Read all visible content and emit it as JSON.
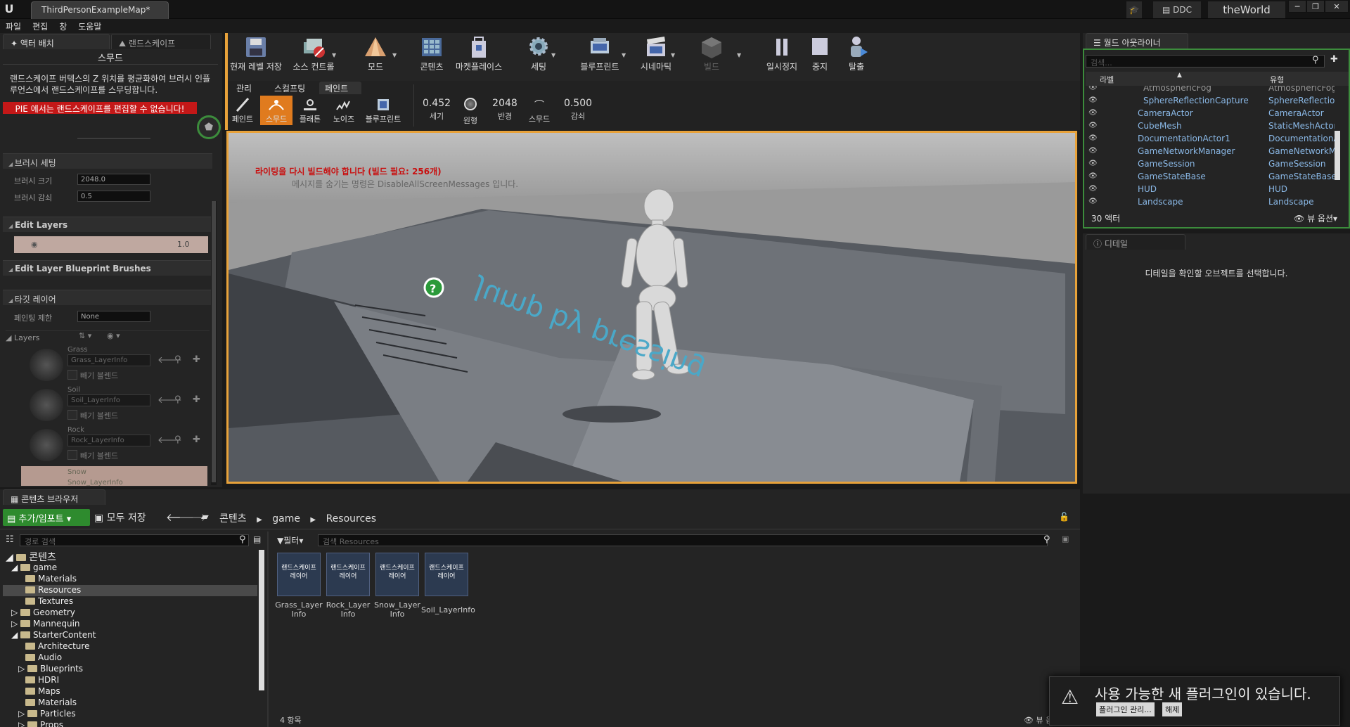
{
  "app": {
    "document_tab": "ThirdPersonExampleMap*",
    "ddc": "DDC",
    "world": "theWorld"
  },
  "menu": [
    "파일",
    "편집",
    "창",
    "도움말"
  ],
  "left_panel": {
    "tabs": [
      "액터 배치",
      "랜드스케이프"
    ],
    "tool_title": "스무드",
    "description": "랜드스케이프 버텍스의 Z 위치를 평균화하여 브러시 인플루언스에서 랜드스케이프를 스무딩합니다.",
    "pie_warning": "PIE 에서는 랜드스케이프를 편집할 수 없습니다!",
    "brush_section": "브러시 세팅",
    "brush_size_label": "브러시 크기",
    "brush_size_value": "2048.0",
    "brush_falloff_label": "브러시 감쇠",
    "brush_falloff_value": "0.5",
    "edit_layers": "Edit Layers",
    "edit_layers_value": "1.0",
    "edit_layer_bp": "Edit Layer Blueprint Brushes",
    "target_layers": "타깃 레이어",
    "paint_restrict_label": "페인팅 제한",
    "paint_restrict_value": "None",
    "layers_label": "Layers",
    "layers": [
      {
        "name": "Grass",
        "info": "Grass_LayerInfo",
        "blend": "빼기 블렌드"
      },
      {
        "name": "Soil",
        "info": "Soil_LayerInfo",
        "blend": "빼기 블렌드"
      },
      {
        "name": "Rock",
        "info": "Rock_LayerInfo",
        "blend": "빼기 블렌드"
      },
      {
        "name": "Snow",
        "info": "Snow_LayerInfo",
        "blend": ""
      }
    ]
  },
  "toolbar": {
    "items": [
      "현재 레벨 저장",
      "소스 컨트롤",
      "모드",
      "콘텐츠",
      "마켓플레이스",
      "세팅",
      "블루프린트",
      "시네마틱",
      "빌드",
      "일시정지",
      "중지",
      "탈출"
    ]
  },
  "mode_tabs": [
    "관리",
    "스컬프팅",
    "페인트"
  ],
  "paint_tools": [
    "페인트",
    "스무드",
    "플래튼",
    "노이즈",
    "블루프린트"
  ],
  "paint_values": [
    {
      "value": "0.452",
      "label": "세기"
    },
    {
      "value": "",
      "label": "원형"
    },
    {
      "value": "2048",
      "label": "반경"
    },
    {
      "value": "",
      "label": "스무드"
    },
    {
      "value": "0.500",
      "label": "감쇠"
    }
  ],
  "viewport": {
    "msg_red": "라이팅을 다시 빌드해야 합니다 (빌드 필요: 256개)",
    "msg_gray": "메시지를 숨기는 명령은 DisableAllScreenMessages 입니다.",
    "floor_text": "Jump by pressing"
  },
  "outliner": {
    "tab": "월드 아웃라이너",
    "search_placeholder": "검색...",
    "col_label": "라벨",
    "col_type": "유형",
    "rows": [
      {
        "name": "AtmosphericFog",
        "type": "AtmosphericFog"
      },
      {
        "name": "SphereReflectionCapture",
        "type": "SphereReflectionC"
      },
      {
        "name": "CameraActor",
        "type": "CameraActor"
      },
      {
        "name": "CubeMesh",
        "type": "StaticMeshActor"
      },
      {
        "name": "DocumentationActor1",
        "type": "DocumentationAc"
      },
      {
        "name": "GameNetworkManager",
        "type": "GameNetworkMar"
      },
      {
        "name": "GameSession",
        "type": "GameSession"
      },
      {
        "name": "GameStateBase",
        "type": "GameStateBase"
      },
      {
        "name": "HUD",
        "type": "HUD"
      },
      {
        "name": "Landscape",
        "type": "Landscape"
      }
    ],
    "count": "30 액터",
    "view_options": "뷰 옵션"
  },
  "details": {
    "tab": "디테일",
    "empty": "디테일을 확인할 오브젝트를 선택합니다."
  },
  "content_browser": {
    "tab": "콘텐츠 브라우저",
    "add_import": "추가/임포트",
    "save_all": "모두 저장",
    "breadcrumbs": [
      "콘텐츠",
      "game",
      "Resources"
    ],
    "path_search_placeholder": "경로 검색",
    "filter": "필터",
    "search_placeholder": "검색 Resources",
    "tree": [
      {
        "label": "콘텐츠",
        "depth": 0
      },
      {
        "label": "game",
        "depth": 1
      },
      {
        "label": "Materials",
        "depth": 2
      },
      {
        "label": "Resources",
        "depth": 2
      },
      {
        "label": "Textures",
        "depth": 2
      },
      {
        "label": "Geometry",
        "depth": 1
      },
      {
        "label": "Mannequin",
        "depth": 1
      },
      {
        "label": "StarterContent",
        "depth": 1
      },
      {
        "label": "Architecture",
        "depth": 2
      },
      {
        "label": "Audio",
        "depth": 2
      },
      {
        "label": "Blueprints",
        "depth": 2
      },
      {
        "label": "HDRI",
        "depth": 2
      },
      {
        "label": "Maps",
        "depth": 2
      },
      {
        "label": "Materials",
        "depth": 2
      },
      {
        "label": "Particles",
        "depth": 2
      },
      {
        "label": "Props",
        "depth": 2
      }
    ],
    "asset_kind": "랜드스케이프 레이어",
    "assets": [
      "Grass_Layer Info",
      "Rock_Layer Info",
      "Snow_Layer Info",
      "Soil_LayerInfo"
    ],
    "count": "4 항목",
    "view_options": "뷰 옵션"
  },
  "notification": {
    "text": "사용 가능한 새 플러그인이 있습니다.",
    "manage": "플러그인 관리...",
    "dismiss": "해제"
  },
  "colors": {
    "accent_orange": "#e8a23a",
    "selected_tool": "#e07b1e",
    "warning_red": "#c41818",
    "add_green": "#2e8b2e"
  }
}
